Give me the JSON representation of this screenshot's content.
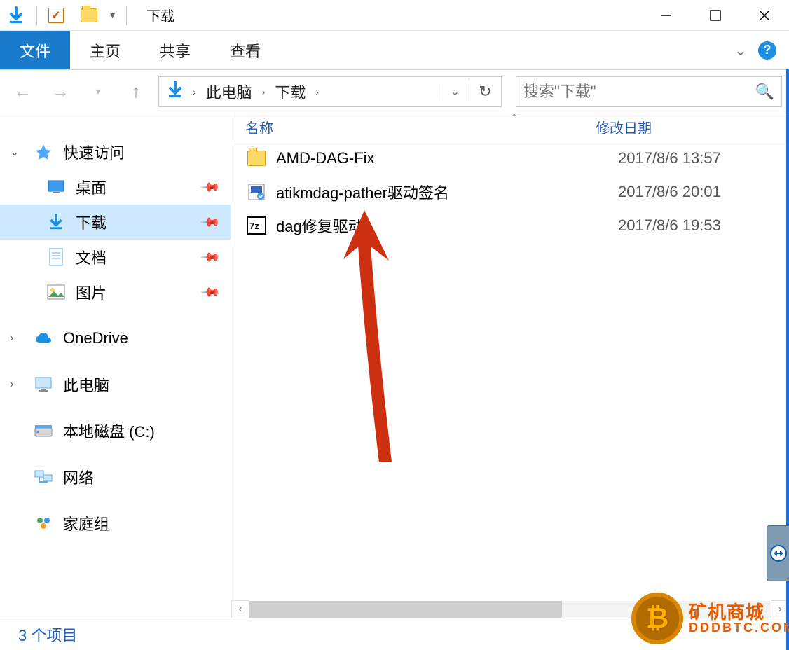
{
  "window": {
    "title": "下载"
  },
  "ribbon": {
    "file_label": "文件",
    "tabs": [
      {
        "label": "主页"
      },
      {
        "label": "共享"
      },
      {
        "label": "查看"
      }
    ]
  },
  "breadcrumb": {
    "segments": [
      {
        "label": "此电脑"
      },
      {
        "label": "下载"
      }
    ]
  },
  "search": {
    "placeholder": "搜索\"下载\""
  },
  "sidebar": {
    "quick_access": {
      "label": "快速访问",
      "expanded": true,
      "items": [
        {
          "label": "桌面",
          "icon": "desktop",
          "pinned": true
        },
        {
          "label": "下载",
          "icon": "download",
          "pinned": true,
          "selected": true
        },
        {
          "label": "文档",
          "icon": "document",
          "pinned": true
        },
        {
          "label": "图片",
          "icon": "picture",
          "pinned": true
        }
      ]
    },
    "onedrive": {
      "label": "OneDrive",
      "expanded": false
    },
    "this_pc": {
      "label": "此电脑",
      "expanded": false
    },
    "local_c": {
      "label": "本地磁盘 (C:)"
    },
    "network": {
      "label": "网络"
    },
    "homegroup": {
      "label": "家庭组"
    }
  },
  "columns": {
    "name": "名称",
    "date": "修改日期"
  },
  "files": [
    {
      "icon": "folder",
      "name": "AMD-DAG-Fix",
      "date": "2017/8/6 13:57"
    },
    {
      "icon": "bat",
      "name": "atikmdag-pather驱动签名",
      "date": "2017/8/6 20:01"
    },
    {
      "icon": "7z",
      "name": "dag修复驱动",
      "date": "2017/8/6 19:53"
    }
  ],
  "status": {
    "item_count_label": "3 个项目"
  },
  "watermark": {
    "line1": "矿机商城",
    "line2": "DDDBTC.COM"
  }
}
